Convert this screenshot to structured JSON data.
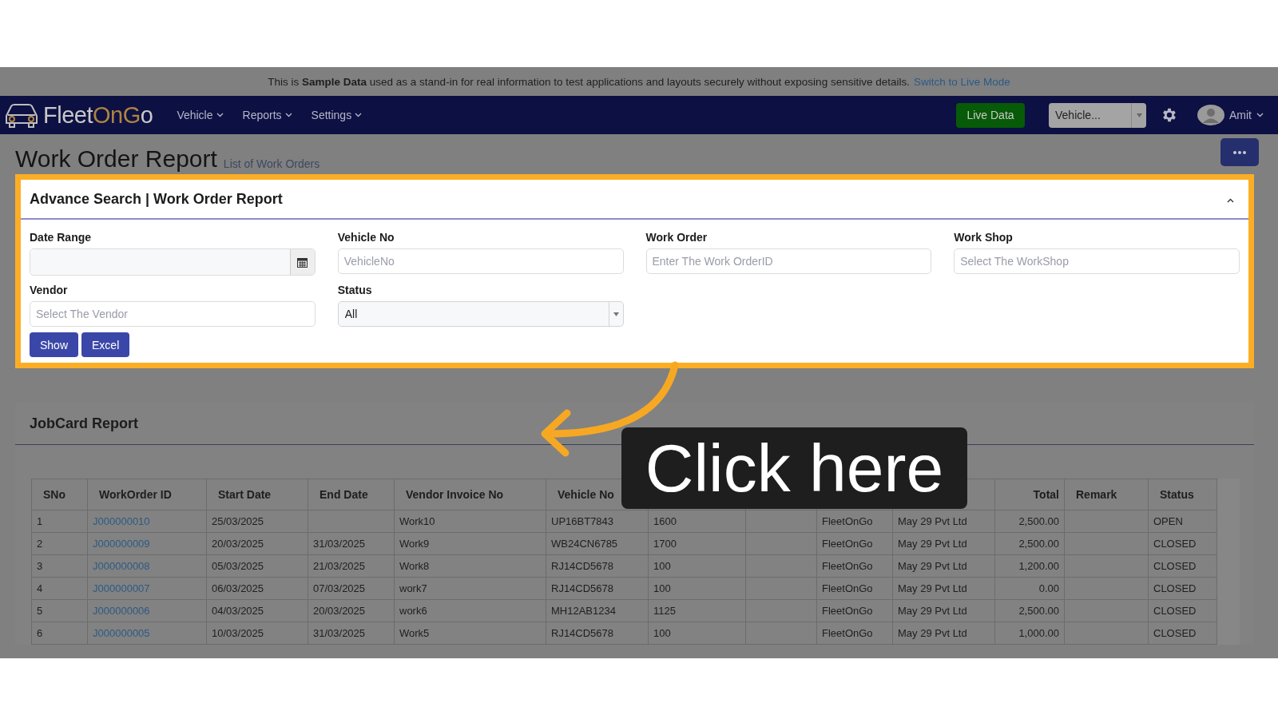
{
  "banner": {
    "text": "This is **Sample Data** used as a stand-in for real information to test applications and layouts securely without exposing sensitive details.",
    "link": "Switch to Live Mode"
  },
  "nav": {
    "logo_parts": [
      {
        "text": "Fleet",
        "accent": false
      },
      {
        "text": "OnG",
        "accent": true
      },
      {
        "text": "o",
        "accent": false
      }
    ],
    "menus": [
      "Vehicle",
      "Reports",
      "Settings"
    ],
    "live_button": "Live Data",
    "vehicle_select": "Vehicle...",
    "user": "Amit"
  },
  "page": {
    "title": "Work Order Report",
    "subtitle": "List of Work Orders"
  },
  "search": {
    "title": "Advance Search | Work Order Report",
    "expanded": true,
    "fields": [
      {
        "label": "Date Range",
        "kind": "date"
      },
      {
        "label": "Vehicle No",
        "kind": "text",
        "placeholder": "VehicleNo"
      },
      {
        "label": "Work Order",
        "kind": "text",
        "placeholder": "Enter The Work OrderID"
      },
      {
        "label": "Work Shop",
        "kind": "text",
        "placeholder": "Select The WorkShop"
      },
      {
        "label": "Vendor",
        "kind": "text",
        "placeholder": "Select The Vendor"
      },
      {
        "label": "Status",
        "kind": "select",
        "value": "All"
      }
    ],
    "buttons": [
      "Show",
      "Excel"
    ]
  },
  "jobcard": {
    "title": "JobCard Report",
    "columns": [
      {
        "label": "SNo",
        "kind": "text"
      },
      {
        "label": "WorkOrder ID",
        "kind": "link"
      },
      {
        "label": "Start Date",
        "kind": "text"
      },
      {
        "label": "End Date",
        "kind": "text"
      },
      {
        "label": "Vendor Invoice No",
        "kind": "text"
      },
      {
        "label": "Vehicle No",
        "kind": "text"
      },
      {
        "kind": "text"
      },
      {
        "kind": "text"
      },
      {
        "kind": "text"
      },
      {
        "kind": "text"
      },
      {
        "label": "Total",
        "kind": "number"
      },
      {
        "label": "Remark",
        "kind": "text"
      },
      {
        "label": "Status",
        "kind": "text"
      }
    ],
    "rows": [
      [
        "1",
        "J000000010",
        "25/03/2025",
        "",
        "Work10",
        "UP16BT7843",
        "1600",
        "",
        "FleetOnGo",
        "May 29 Pvt Ltd",
        "2,500.00",
        "",
        "OPEN"
      ],
      [
        "2",
        "J000000009",
        "20/03/2025",
        "31/03/2025",
        "Work9",
        "WB24CN6785",
        "1700",
        "",
        "FleetOnGo",
        "May 29 Pvt Ltd",
        "2,500.00",
        "",
        "CLOSED"
      ],
      [
        "3",
        "J000000008",
        "05/03/2025",
        "21/03/2025",
        "Work8",
        "RJ14CD5678",
        "100",
        "",
        "FleetOnGo",
        "May 29 Pvt Ltd",
        "1,200.00",
        "",
        "CLOSED"
      ],
      [
        "4",
        "J000000007",
        "06/03/2025",
        "07/03/2025",
        "work7",
        "RJ14CD5678",
        "100",
        "",
        "FleetOnGo",
        "May 29 Pvt Ltd",
        "0.00",
        "",
        "CLOSED"
      ],
      [
        "5",
        "J000000006",
        "04/03/2025",
        "20/03/2025",
        "work6",
        "MH12AB1234",
        "1125",
        "",
        "FleetOnGo",
        "May 29 Pvt Ltd",
        "2,500.00",
        "",
        "CLOSED"
      ],
      [
        "6",
        "J000000005",
        "10/03/2025",
        "31/03/2025",
        "Work5",
        "RJ14CD5678",
        "100",
        "",
        "FleetOnGo",
        "May 29 Pvt Ltd",
        "1,000.00",
        "",
        "CLOSED"
      ]
    ]
  },
  "tutorial": {
    "callout": "Click here"
  }
}
